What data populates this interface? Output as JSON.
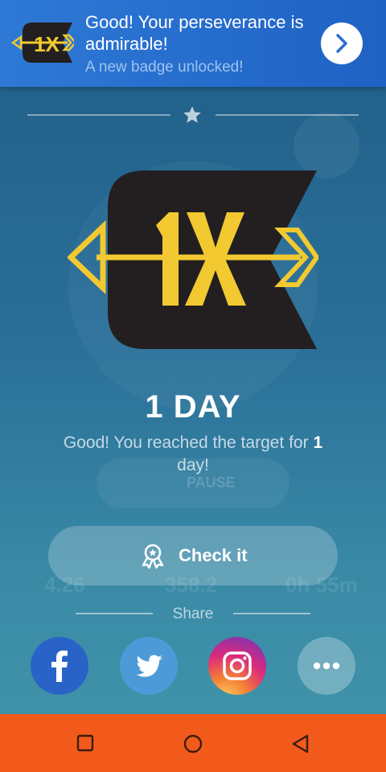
{
  "banner": {
    "title": "Good! Your perseverance is admirable!",
    "subtitle": "A new badge unlocked!",
    "badge_icon": "1x-arrow-badge-icon",
    "go_icon": "chevron-right-icon"
  },
  "badge": {
    "text": "1X"
  },
  "achievement": {
    "title": "1 DAY",
    "message_before": "Good! You reached the target for ",
    "message_count": "1",
    "message_after": " day!"
  },
  "check_button": {
    "label": "Check it",
    "icon": "award-ribbon-icon"
  },
  "share": {
    "label": "Share",
    "buttons": [
      "facebook",
      "twitter",
      "instagram",
      "more"
    ]
  },
  "background_screen": {
    "pause_label": "PAUSE",
    "stat_1": "4.26",
    "stat_2": "358.2",
    "stat_3": "0h 55m"
  },
  "nav": {
    "recent": "square-icon",
    "home": "circle-icon",
    "back": "triangle-back-icon"
  },
  "colors": {
    "banner": "#2e79d6",
    "gold": "#f2c930",
    "badge_dark": "#231f20",
    "facebook": "#2a63c8",
    "twitter": "#4c9bd8",
    "navbar": "#f25a1c"
  }
}
